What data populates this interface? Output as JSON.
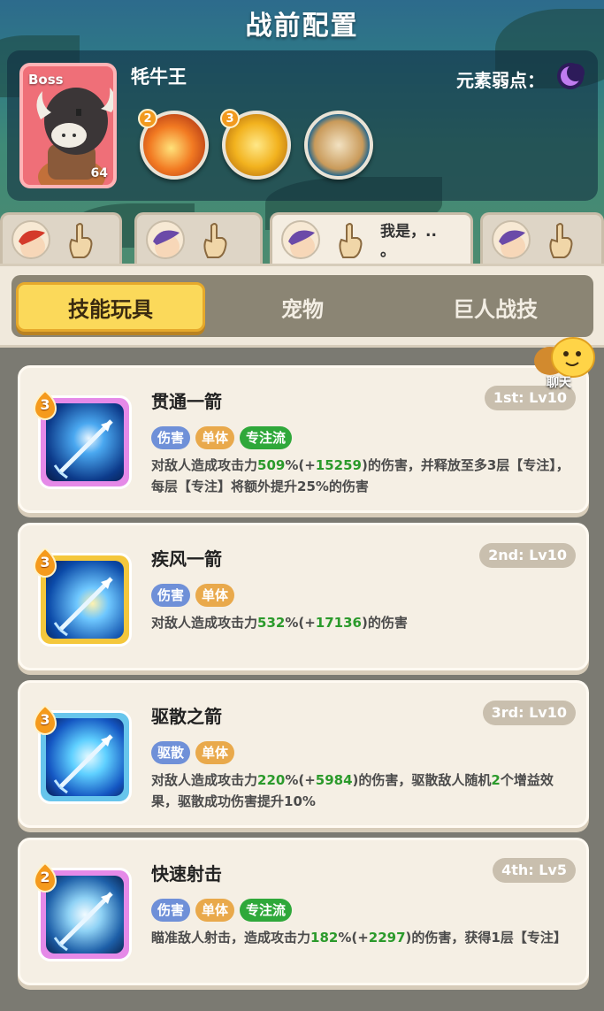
{
  "page_title": "战前配置",
  "boss": {
    "tag": "Boss",
    "name": "牦牛王",
    "level": "64",
    "weakness_label": "元素弱点：",
    "weakness_icon": "moon-icon"
  },
  "elements": [
    {
      "icon": "fire-element-icon",
      "count": "2"
    },
    {
      "icon": "gold-ring-element-icon",
      "count": "3"
    },
    {
      "icon": "earth-rock-element-icon",
      "count": ""
    }
  ],
  "party": [
    {
      "hero": "red-hair-hero",
      "chat": ""
    },
    {
      "hero": "purple-hair-hero",
      "chat": ""
    },
    {
      "hero": "purple-hair-hero",
      "chat": "我是，..\n。"
    },
    {
      "hero": "purple-hair-hero",
      "chat": ""
    }
  ],
  "tabs": [
    {
      "label": "技能玩具",
      "active": true
    },
    {
      "label": "宠物",
      "active": false
    },
    {
      "label": "巨人战技",
      "active": false
    }
  ],
  "chat_button": {
    "label": "聊天"
  },
  "skills": [
    {
      "name": "贯通一箭",
      "slot": "1st: Lv10",
      "star": "3",
      "frame_color": "#e58ae8",
      "tags": [
        {
          "label": "伤害",
          "color": "#6f90d8"
        },
        {
          "label": "单体",
          "color": "#e9a94b"
        },
        {
          "label": "专注流",
          "color": "#2fa83a"
        }
      ],
      "desc": [
        {
          "t": "对敌人造成攻击力"
        },
        {
          "t": "509",
          "g": true
        },
        {
          "t": "%(+"
        },
        {
          "t": "15259",
          "g": true
        },
        {
          "t": ")的伤害，并释放至多3层【专注】，每层【专注】将额外提升25%的伤害"
        }
      ]
    },
    {
      "name": "疾风一箭",
      "slot": "2nd: Lv10",
      "star": "3",
      "frame_color": "#f4c73c",
      "tags": [
        {
          "label": "伤害",
          "color": "#6f90d8"
        },
        {
          "label": "单体",
          "color": "#e9a94b"
        }
      ],
      "desc": [
        {
          "t": "对敌人造成攻击力"
        },
        {
          "t": "532",
          "g": true
        },
        {
          "t": "%(+"
        },
        {
          "t": "17136",
          "g": true
        },
        {
          "t": ")的伤害"
        }
      ]
    },
    {
      "name": "驱散之箭",
      "slot": "3rd: Lv10",
      "star": "3",
      "frame_color": "#67c5ec",
      "tags": [
        {
          "label": "驱散",
          "color": "#6f90d8"
        },
        {
          "label": "单体",
          "color": "#e9a94b"
        }
      ],
      "desc": [
        {
          "t": "对敌人造成攻击力"
        },
        {
          "t": "220",
          "g": true
        },
        {
          "t": "%(+"
        },
        {
          "t": "5984",
          "g": true
        },
        {
          "t": ")的伤害，驱散敌人随机"
        },
        {
          "t": "2",
          "g": true
        },
        {
          "t": "个增益效果，驱散成功伤害提升10%"
        }
      ]
    },
    {
      "name": "快速射击",
      "slot": "4th: Lv5",
      "star": "2",
      "frame_color": "#e58ae8",
      "tags": [
        {
          "label": "伤害",
          "color": "#6f90d8"
        },
        {
          "label": "单体",
          "color": "#e9a94b"
        },
        {
          "label": "专注流",
          "color": "#2fa83a"
        }
      ],
      "desc": [
        {
          "t": "瞄准敌人射击，造成攻击力"
        },
        {
          "t": "182",
          "g": true
        },
        {
          "t": "%(+"
        },
        {
          "t": "2297",
          "g": true
        },
        {
          "t": ")的伤害，获得1层【专注】"
        }
      ]
    }
  ]
}
